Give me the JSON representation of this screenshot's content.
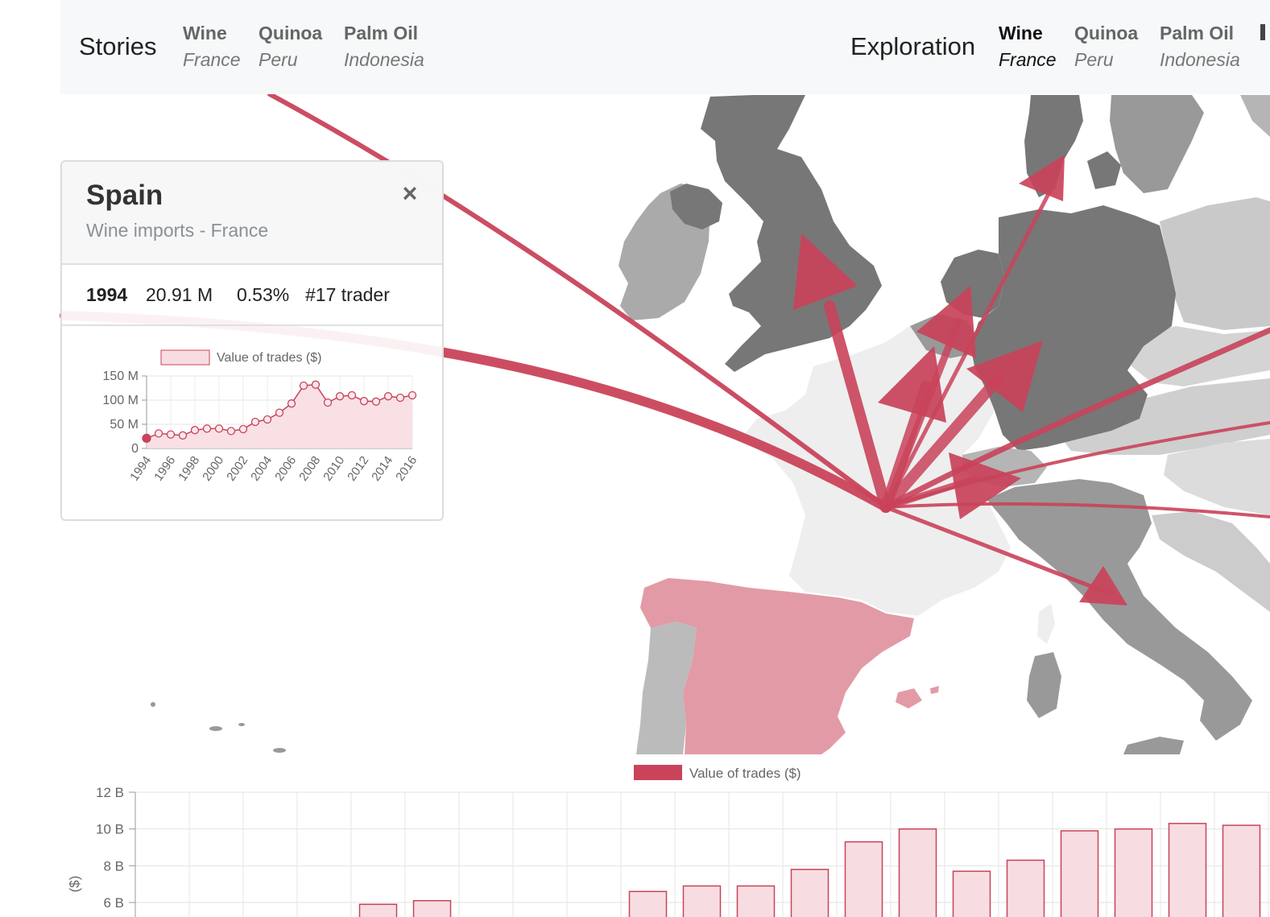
{
  "nav": {
    "stories": {
      "heading": "Stories",
      "items": [
        {
          "crop": "Wine",
          "country": "France"
        },
        {
          "crop": "Quinoa",
          "country": "Peru"
        },
        {
          "crop": "Palm Oil",
          "country": "Indonesia"
        }
      ]
    },
    "exploration": {
      "heading": "Exploration",
      "items": [
        {
          "crop": "Wine",
          "country": "France",
          "active": true
        },
        {
          "crop": "Quinoa",
          "country": "Peru"
        },
        {
          "crop": "Palm Oil",
          "country": "Indonesia"
        }
      ]
    }
  },
  "colors": {
    "accent": "#c9435a",
    "accent_fill": "#f7dde2",
    "spain_fill": "#e29ba6",
    "navbar_bg": "#f7f8f9"
  },
  "panel": {
    "title": "Spain",
    "subtitle": "Wine imports - France",
    "close_icon": "×",
    "stats": {
      "year": "1994",
      "value": "20.91 M",
      "share": "0.53%",
      "rank": "#17 trader"
    }
  },
  "chart_data": [
    {
      "type": "line",
      "legend": [
        "Value of trades ($)"
      ],
      "x": [
        1994,
        1995,
        1996,
        1997,
        1998,
        1999,
        2000,
        2001,
        2002,
        2003,
        2004,
        2005,
        2006,
        2007,
        2008,
        2009,
        2010,
        2011,
        2012,
        2013,
        2014,
        2015,
        2016
      ],
      "series": [
        {
          "name": "Value of trades ($)",
          "values": [
            21,
            31,
            29,
            27,
            38,
            41,
            41,
            36,
            40,
            55,
            60,
            74,
            93,
            130,
            132,
            95,
            108,
            110,
            98,
            97,
            108,
            105,
            110
          ]
        }
      ],
      "y_ticks": [
        "0",
        "50 M",
        "100 M",
        "150 M"
      ],
      "x_ticks": [
        "1994",
        "1996",
        "1998",
        "2000",
        "2002",
        "2004",
        "2006",
        "2008",
        "2010",
        "2012",
        "2014",
        "2016"
      ],
      "ylim": [
        0,
        150
      ],
      "highlight_x": 1994,
      "grid": true,
      "legend_position": "top"
    },
    {
      "type": "bar",
      "legend": [
        "Value of trades ($)"
      ],
      "ylabel": "($)",
      "y_ticks": [
        "6 B",
        "8 B",
        "10 B",
        "12 B"
      ],
      "ylim_visible": [
        5.4,
        12
      ],
      "values": [
        null,
        null,
        null,
        null,
        5.9,
        6.1,
        null,
        null,
        null,
        6.6,
        6.9,
        6.9,
        7.8,
        9.3,
        10.0,
        7.7,
        8.3,
        9.9,
        10.0,
        10.3,
        10.2
      ],
      "grid": true,
      "legend_position": "top"
    }
  ]
}
